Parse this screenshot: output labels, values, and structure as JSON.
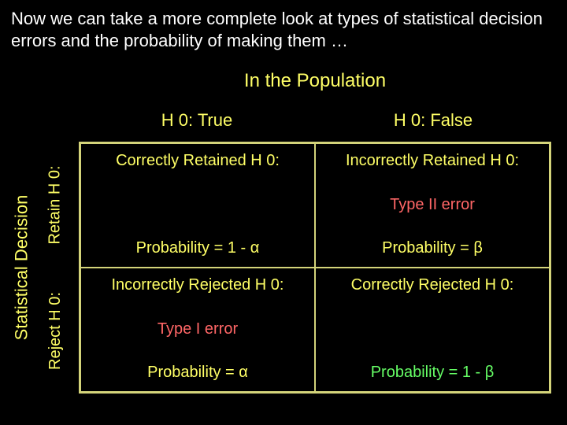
{
  "intro": "Now we can take a more complete look at types of statistical decision errors and the probability of making them …",
  "pop_head": "In the Population",
  "col_heads": {
    "true": "H 0:  True",
    "false": "H 0:  False"
  },
  "row_outer": "Statistical Decision",
  "row_inner": {
    "retain": "Retain H 0:",
    "reject": "Reject H 0:"
  },
  "cells": {
    "retain_true": {
      "title": "Correctly Retained H 0:",
      "err": "",
      "prob": "Probability  =  1 - α"
    },
    "retain_false": {
      "title": "Incorrectly Retained H 0:",
      "err": "Type II  error",
      "prob": "Probability  =  β"
    },
    "reject_true": {
      "title": "Incorrectly Rejected H 0:",
      "err": "Type I  error",
      "prob": "Probability  =   α"
    },
    "reject_false": {
      "title": "Correctly Rejected H 0:",
      "err": "",
      "prob": "Probability  =  1 - β"
    }
  },
  "chart_data": {
    "type": "table",
    "title": "Statistical decision error matrix",
    "row_label": "Statistical Decision",
    "col_label": "In the Population",
    "rows": [
      "Retain H0",
      "Reject H0"
    ],
    "cols": [
      "H0: True",
      "H0: False"
    ],
    "cells": [
      [
        {
          "outcome": "Correctly Retained H0",
          "error_type": null,
          "probability": "1 - α"
        },
        {
          "outcome": "Incorrectly Retained H0",
          "error_type": "Type II error",
          "probability": "β"
        }
      ],
      [
        {
          "outcome": "Incorrectly Rejected H0",
          "error_type": "Type I error",
          "probability": "α"
        },
        {
          "outcome": "Correctly Rejected H0",
          "error_type": null,
          "probability": "1 - β"
        }
      ]
    ]
  }
}
